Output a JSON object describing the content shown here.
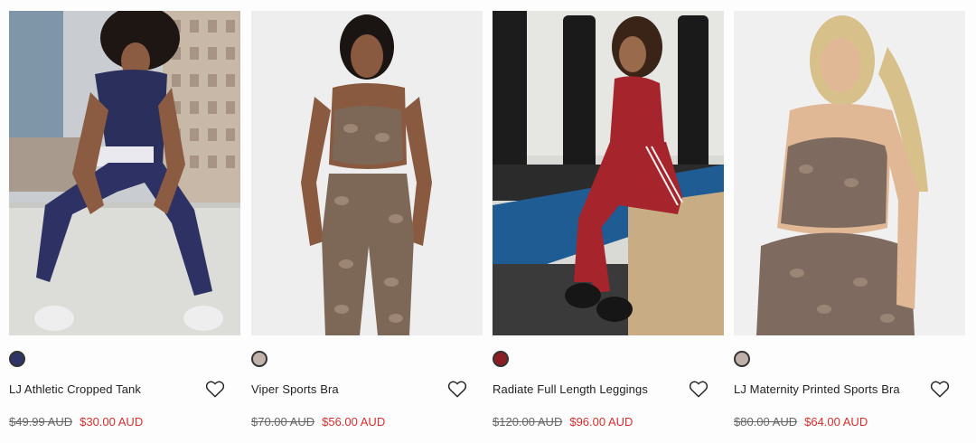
{
  "colors": {
    "sale": "#d32f2f",
    "regular": "#666666"
  },
  "products": [
    {
      "name": "LJ Athletic Cropped Tank",
      "swatch_color": "#2e3466",
      "was_price": "$49.99 AUD",
      "now_price": "$30.00 AUD",
      "photo_subject": "model in navy cropped tank and leggings sitting on concrete wall"
    },
    {
      "name": "Viper Sports Bra",
      "swatch_color": "#c2b3aa",
      "was_price": "$70.00 AUD",
      "now_price": "$56.00 AUD",
      "photo_subject": "model in snake print sports bra and leggings"
    },
    {
      "name": "Radiate Full Length Leggings",
      "swatch_color": "#8b1e25",
      "was_price": "$120.00 AUD",
      "now_price": "$96.00 AUD",
      "photo_subject": "model in red leggings sitting on wooden box in gym"
    },
    {
      "name": "LJ Maternity Printed Sports Bra",
      "swatch_color": "#bfb1aa",
      "was_price": "$80.00 AUD",
      "now_price": "$64.00 AUD",
      "photo_subject": "pregnant model in snake print sports bra"
    }
  ]
}
